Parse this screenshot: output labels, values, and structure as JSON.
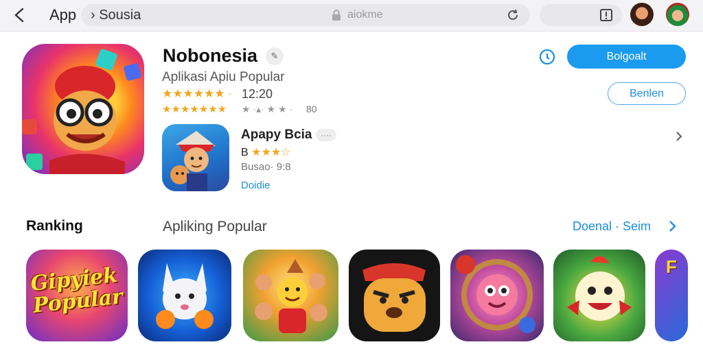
{
  "topbar": {
    "app_label": "App",
    "url_text": "› Sousia",
    "url_host": "aiokme"
  },
  "hero": {
    "title": "Nobonesia",
    "subtitle": "Aplikasi  Apiu Popular",
    "rating_stars": "★★★★★★ ·",
    "rating_value": "12:20",
    "rating2_stars": "★★★★★★★",
    "rating2_extra": "★ ·▴· ★ ★ ·",
    "rating2_value": "80",
    "primary_button": "Bolgoalt",
    "secondary_button": "Benlen"
  },
  "featured": {
    "title": "Apapy Bcia",
    "dots": "····",
    "rating_prefix": "B",
    "rating_stars": "★★★☆",
    "meta": "Busao· 9:8",
    "link": "Doidie"
  },
  "ranking": {
    "title": "Ranking",
    "subtitle": "Apliking Popular",
    "link": "Doenal · Seim",
    "tiles": [
      {
        "name": "Gipyiek Popular",
        "label": "Gipyiek Popular"
      },
      {
        "name": "cat-game"
      },
      {
        "name": "village-game"
      },
      {
        "name": "dog-game"
      },
      {
        "name": "monkey-game"
      },
      {
        "name": "bird-game"
      },
      {
        "name": "letter-game",
        "letter": "F"
      }
    ]
  },
  "colors": {
    "accent": "#1a9bf0",
    "star": "#f2a71c",
    "topbar_bg": "#f3f3f5"
  }
}
